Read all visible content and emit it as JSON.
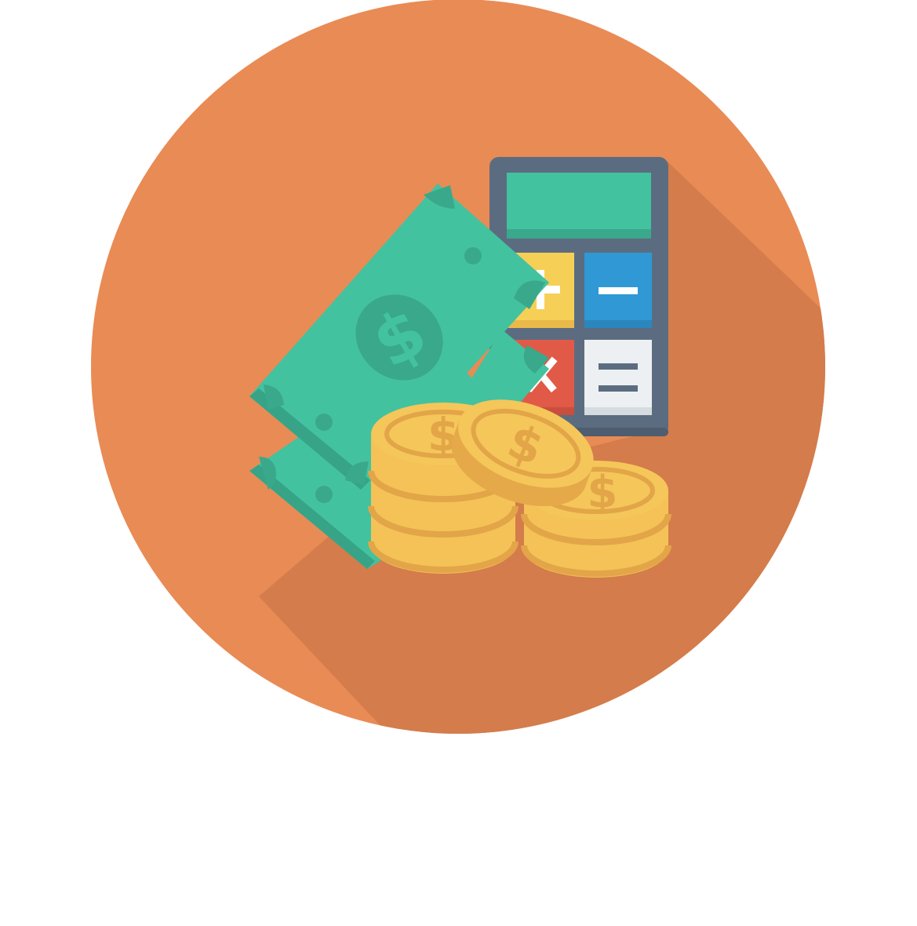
{
  "illustration": {
    "subject": "money-and-calculator-icon",
    "colors": {
      "background": "#ffffff",
      "circle": "#e98b55",
      "long_shadow": "#d47c4b",
      "bill_face": "#43c29f",
      "bill_dark": "#3aa88b",
      "bill_shade": "#37a487",
      "calculator_body": "#5c6c80",
      "calculator_screen": "#43c29f",
      "calculator_screen_edge": "#3aa88b",
      "key_plus": "#f6cf57",
      "key_minus": "#2f98d5",
      "key_times": "#e05a47",
      "key_equals": "#ecf0f2",
      "key_glyph_light": "#ffffff",
      "key_glyph_dark": "#5c6c80",
      "coin_face": "#f5c65a",
      "coin_rim": "#e5a94a",
      "coin_side": "#f4c257",
      "coin_line": "#e2a548"
    },
    "glyphs": {
      "currency_symbol": "$"
    },
    "icons": [
      "circle-background",
      "long-shadow",
      "calculator-icon",
      "dollar-bill-icon",
      "coin-stack-icon"
    ]
  }
}
